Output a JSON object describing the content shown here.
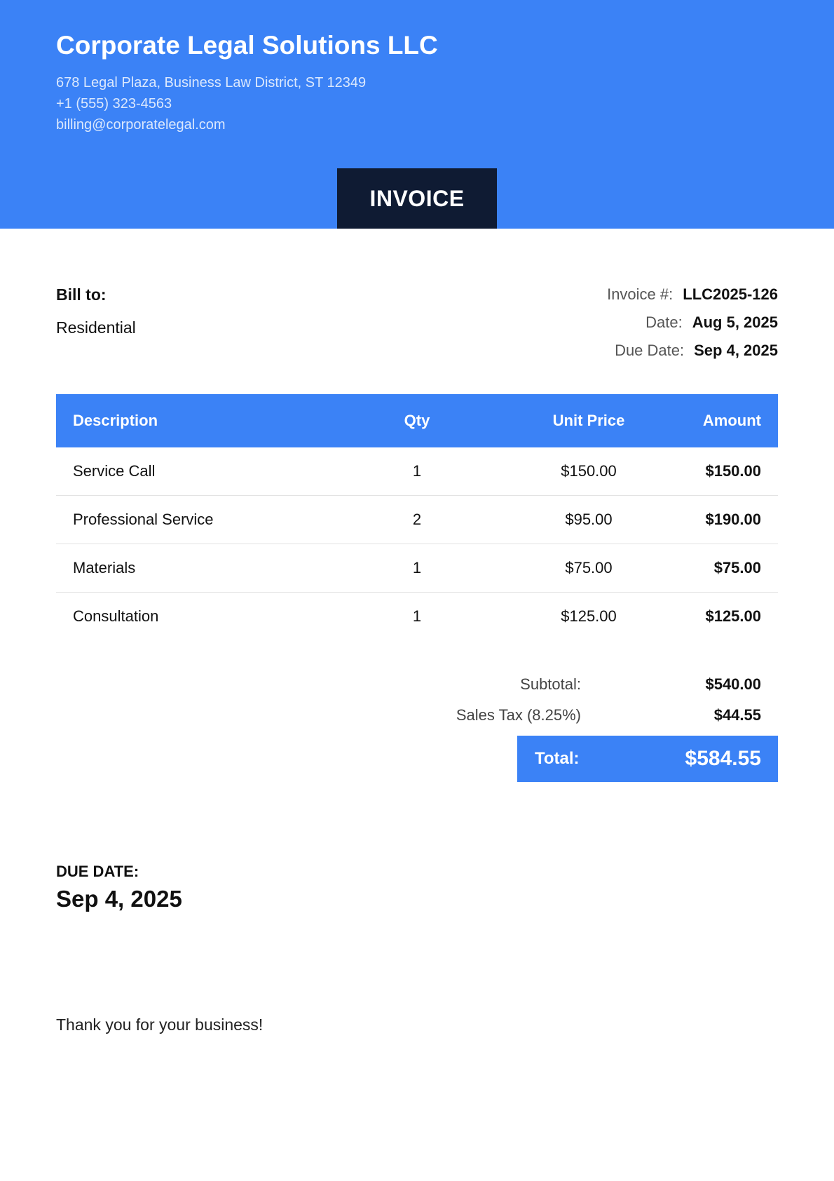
{
  "company": {
    "name": "Corporate Legal Solutions LLC",
    "address": "678 Legal Plaza, Business Law District, ST 12349",
    "phone": "+1 (555) 323-4563",
    "email": "billing@corporatelegal.com"
  },
  "document_title": "INVOICE",
  "bill_to": {
    "label": "Bill to:",
    "name": "Residential"
  },
  "meta": {
    "invoice_number_label": "Invoice #:",
    "invoice_number": "LLC2025-126",
    "date_label": "Date:",
    "date": "Aug 5, 2025",
    "due_date_label": "Due Date:",
    "due_date": "Sep 4, 2025"
  },
  "table": {
    "headers": {
      "description": "Description",
      "qty": "Qty",
      "unit_price": "Unit Price",
      "amount": "Amount"
    },
    "rows": [
      {
        "description": "Service Call",
        "qty": "1",
        "unit_price": "$150.00",
        "amount": "$150.00"
      },
      {
        "description": "Professional Service",
        "qty": "2",
        "unit_price": "$95.00",
        "amount": "$190.00"
      },
      {
        "description": "Materials",
        "qty": "1",
        "unit_price": "$75.00",
        "amount": "$75.00"
      },
      {
        "description": "Consultation",
        "qty": "1",
        "unit_price": "$125.00",
        "amount": "$125.00"
      }
    ]
  },
  "totals": {
    "subtotal_label": "Subtotal:",
    "subtotal": "$540.00",
    "tax_label": "Sales Tax (8.25%)",
    "tax": "$44.55",
    "total_label": "Total:",
    "total": "$584.55"
  },
  "due_section": {
    "label": "DUE DATE:",
    "value": "Sep 4, 2025"
  },
  "footer": {
    "thanks": "Thank you for your business!"
  },
  "colors": {
    "accent": "#3b82f6",
    "badge": "#0f1b33"
  }
}
